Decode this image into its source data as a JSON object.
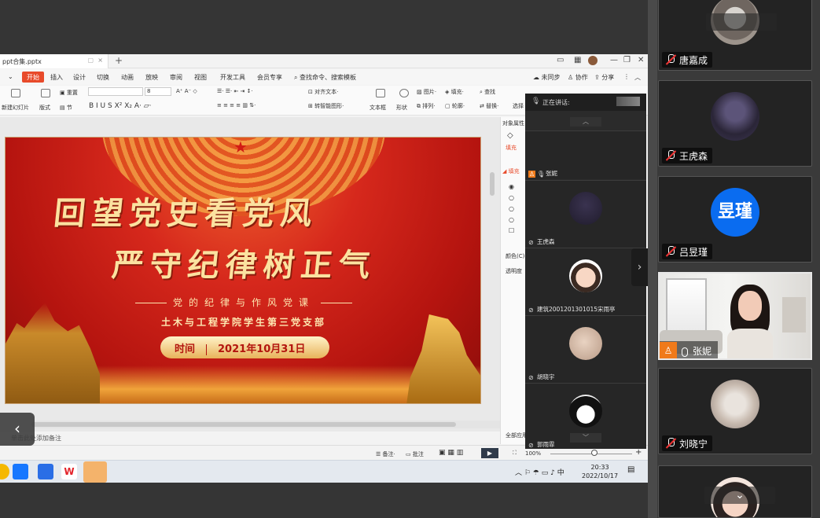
{
  "window": {
    "file_tab": "ppt合集.pptx",
    "add_tab": "+"
  },
  "menubar": {
    "items": [
      "开始",
      "插入",
      "设计",
      "切换",
      "动画",
      "放映",
      "审阅",
      "视图",
      "开发工具",
      "会员专享"
    ],
    "search": "查找命令、搜索模板",
    "unsync": "未同步",
    "collab": "协作",
    "share": "分享"
  },
  "ribbon": {
    "new_slide": "新建幻灯片",
    "layout": "版式",
    "section": "节",
    "reset": "重置",
    "font_size": "8",
    "align_text": "对齐文本",
    "convert_smartart": "转智能图形",
    "textbox": "文本框",
    "shape": "形状",
    "picture": "图片",
    "arrange": "排列",
    "fill": "填充",
    "outline": "轮廓",
    "find": "查找",
    "replace": "替换",
    "select": "选择"
  },
  "slide": {
    "title_line1": "回望党史看党风",
    "title_line2": "严守纪律树正气",
    "subtitle": "党的纪律与作风党课",
    "org": "土木与工程学院学生第三党支部",
    "date_label": "时间",
    "date_value": "2021年10月31日"
  },
  "rightpane": {
    "obj_props": "对象属性",
    "fill_tab": "填充",
    "fill_section": "填充",
    "color": "颜色(C)",
    "transparency": "透明度",
    "apply_all": "全部应用"
  },
  "notes": "单击此处添加备注",
  "statusbar": {
    "notes": "备注",
    "comment": "批注",
    "zoom": "100%"
  },
  "taskbar": {
    "ime": "中",
    "time": "20:33",
    "date": "2022/10/17"
  },
  "minilist": {
    "speaking": "正在讲话:",
    "tiles": [
      {
        "name": "张妮"
      },
      {
        "name": "王虎森"
      },
      {
        "name": "建筑2001201301015宋雨亭"
      },
      {
        "name": "胡晓宇"
      },
      {
        "name": "郭雨霏"
      }
    ]
  },
  "gallery": {
    "tiles": [
      {
        "name": "唐嘉成"
      },
      {
        "name": "王虎森"
      },
      {
        "name": "吕昱瑾",
        "avatar_text": "昱瑾"
      },
      {
        "name": "张妮"
      },
      {
        "name": "刘晓宁"
      }
    ]
  },
  "colors": {
    "accent": "#e84a2a",
    "avatar_blue": "#0a6cf0",
    "host_orange": "#f07a1a"
  }
}
